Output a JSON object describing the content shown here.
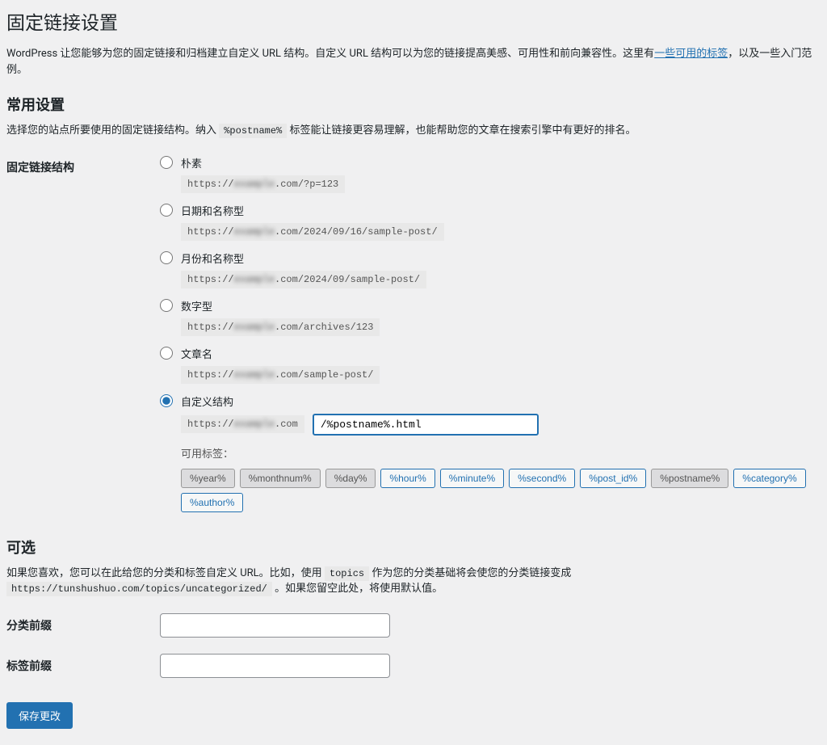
{
  "page": {
    "title": "固定链接设置",
    "intro_before_link": "WordPress 让您能够为您的固定链接和归档建立自定义 URL 结构。自定义 URL 结构可以为您的链接提高美感、可用性和前向兼容性。这里有",
    "intro_link": "一些可用的标签",
    "intro_after_link": "，以及一些入门范例。"
  },
  "common": {
    "heading": "常用设置",
    "description_before": "选择您的站点所要使用的固定链接结构。纳入 ",
    "postname_code": "%postname%",
    "description_after": " 标签能让链接更容易理解，也能帮助您的文章在搜索引擎中有更好的排名。"
  },
  "structure": {
    "label": "固定链接结构",
    "options": {
      "plain": {
        "label": "朴素",
        "url_prefix": "https://",
        "url_blur": "example",
        "url_suffix": ".com/?p=123"
      },
      "day_name": {
        "label": "日期和名称型",
        "url_prefix": "https://",
        "url_blur": "example",
        "url_suffix": ".com/2024/09/16/sample-post/"
      },
      "month_name": {
        "label": "月份和名称型",
        "url_prefix": "https://",
        "url_blur": "example",
        "url_suffix": ".com/2024/09/sample-post/"
      },
      "numeric": {
        "label": "数字型",
        "url_prefix": "https://",
        "url_blur": "example",
        "url_suffix": ".com/archives/123"
      },
      "post_name": {
        "label": "文章名",
        "url_prefix": "https://",
        "url_blur": "example",
        "url_suffix": ".com/sample-post/"
      },
      "custom": {
        "label": "自定义结构",
        "url_prefix": "https://",
        "url_blur": "example",
        "url_suffix": ".com",
        "input_value": "/%postname%.html"
      }
    },
    "available_tags_label": "可用标签：",
    "tags": [
      {
        "label": "%year%",
        "active": true
      },
      {
        "label": "%monthnum%",
        "active": true
      },
      {
        "label": "%day%",
        "active": true
      },
      {
        "label": "%hour%",
        "active": false
      },
      {
        "label": "%minute%",
        "active": false
      },
      {
        "label": "%second%",
        "active": false
      },
      {
        "label": "%post_id%",
        "active": false
      },
      {
        "label": "%postname%",
        "active": true
      },
      {
        "label": "%category%",
        "active": false
      },
      {
        "label": "%author%",
        "active": false
      }
    ]
  },
  "optional": {
    "heading": "可选",
    "description_before": "如果您喜欢，您可以在此给您的分类和标签自定义 URL。比如，使用 ",
    "topics_code": "topics",
    "description_middle": " 作为您的分类基础将会使您的分类链接变成 ",
    "url_code": "https://tunshushuo.com/topics/uncategorized/",
    "description_after": " 。如果您留空此处，将使用默认值。",
    "category_base_label": "分类前缀",
    "tag_base_label": "标签前缀"
  },
  "submit": {
    "label": "保存更改"
  }
}
